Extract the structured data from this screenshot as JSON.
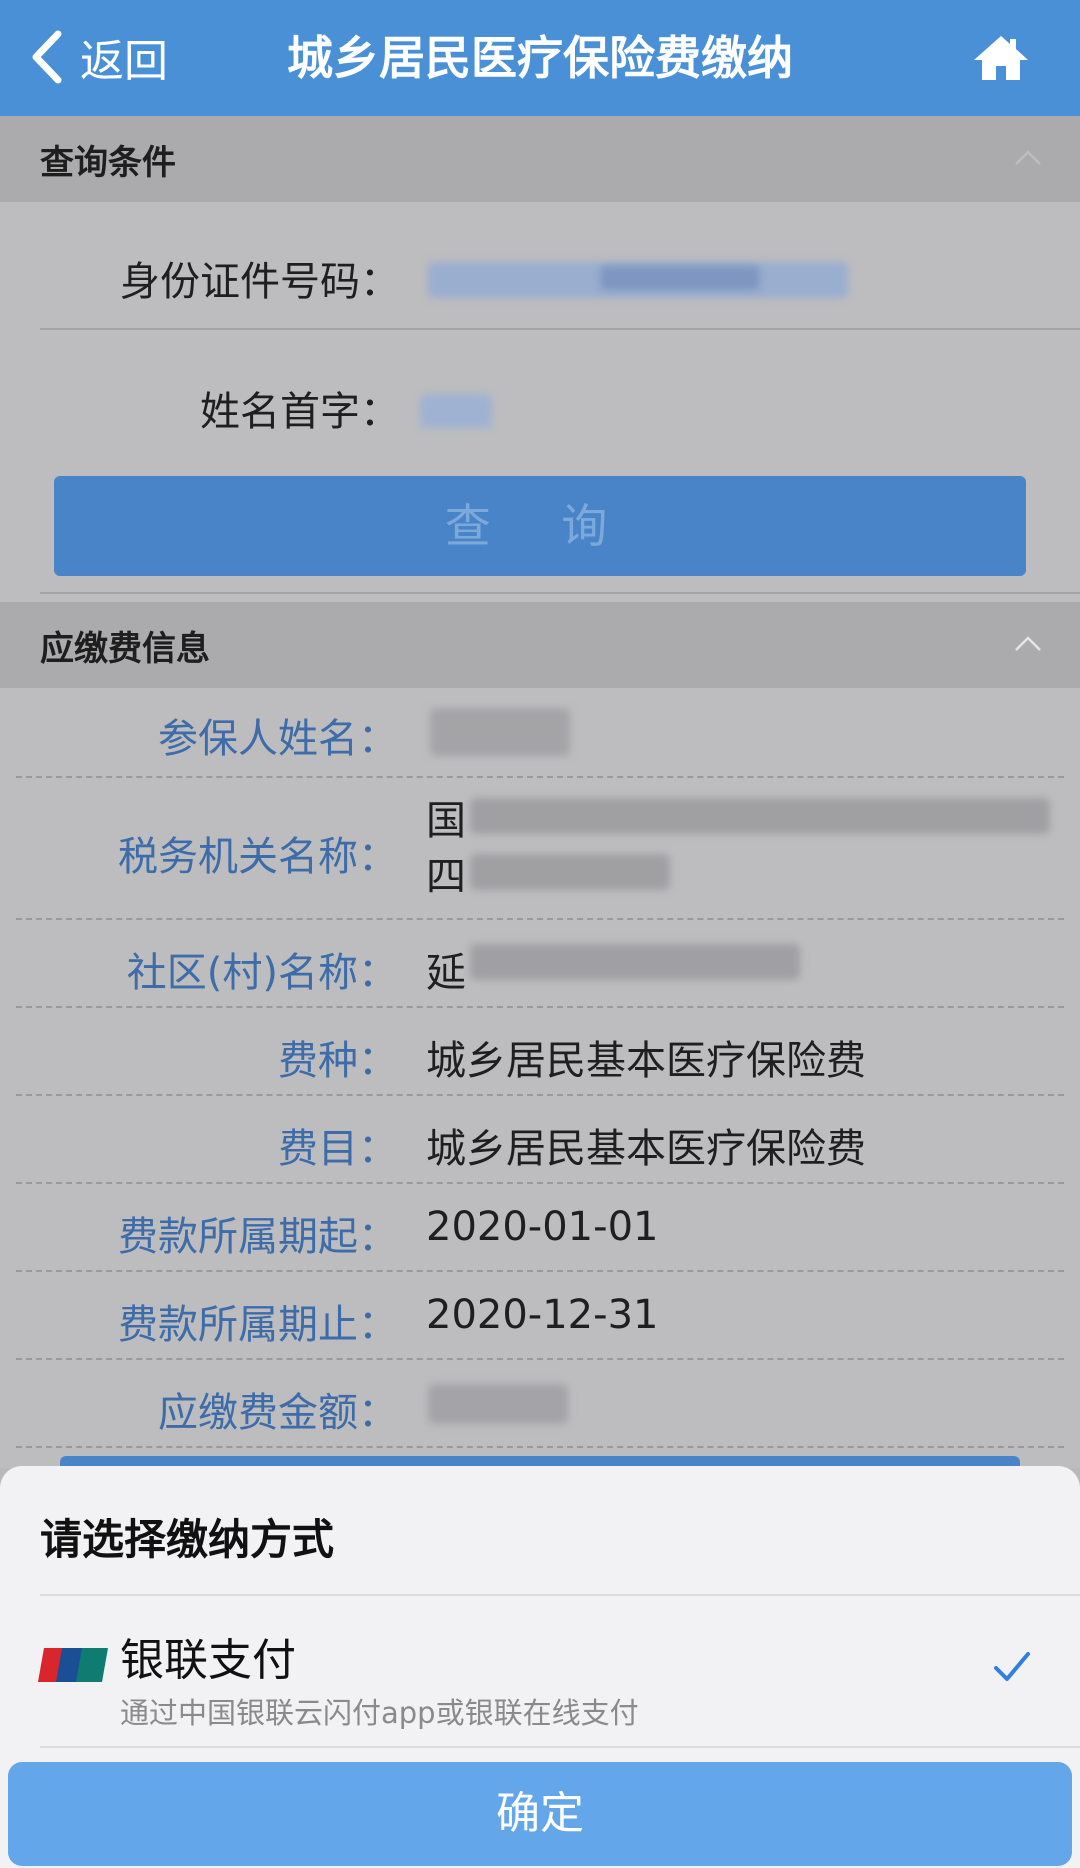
{
  "nav": {
    "back_label": "返回",
    "title": "城乡居民医疗保险费缴纳"
  },
  "query_section": {
    "title": "查询条件",
    "id_label": "身份证件号码：",
    "name_initial_label": "姓名首字：",
    "query_button": "查  询"
  },
  "info_section": {
    "title": "应缴费信息",
    "rows": [
      {
        "label": "参保人姓名：",
        "value": ""
      },
      {
        "label": "税务机关名称：",
        "value": "国",
        "value2": "四"
      },
      {
        "label": "社区(村)名称：",
        "value": "延"
      },
      {
        "label": "费种：",
        "value": "城乡居民基本医疗保险费"
      },
      {
        "label": "费目：",
        "value": "城乡居民基本医疗保险费"
      },
      {
        "label": "费款所属期起：",
        "value": "2020-01-01"
      },
      {
        "label": "费款所属期止：",
        "value": "2020-12-31"
      },
      {
        "label": "应缴费金额：",
        "value": ""
      }
    ]
  },
  "payment_sheet": {
    "title": "请选择缴纳方式",
    "option": {
      "name": "银联支付",
      "description": "通过中国银联云闪付app或银联在线支付",
      "icon": "unionpay-logo",
      "selected": true
    },
    "confirm_button": "确定"
  },
  "colors": {
    "nav_bg": "#4a90d6",
    "label_blue": "#3d6ca8",
    "confirm_bg": "#63a6ea",
    "check_blue": "#2f7fe0"
  }
}
